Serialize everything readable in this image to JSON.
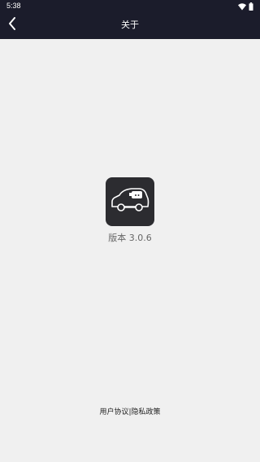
{
  "status_bar": {
    "time": "5:38",
    "icons": [
      "wifi-icon",
      "battery-icon"
    ]
  },
  "nav": {
    "title": "关于",
    "back_icon": "chevron-left-icon"
  },
  "app": {
    "icon": "car-icon",
    "version_label": "版本",
    "version_number": "3.0.6"
  },
  "footer": {
    "user_agreement": "用户协议",
    "separator": "|",
    "privacy_policy": "隐私政策"
  },
  "colors": {
    "header_bg": "#1b1c2b",
    "page_bg": "#f0f0f0",
    "icon_bg": "#2c2c30"
  }
}
